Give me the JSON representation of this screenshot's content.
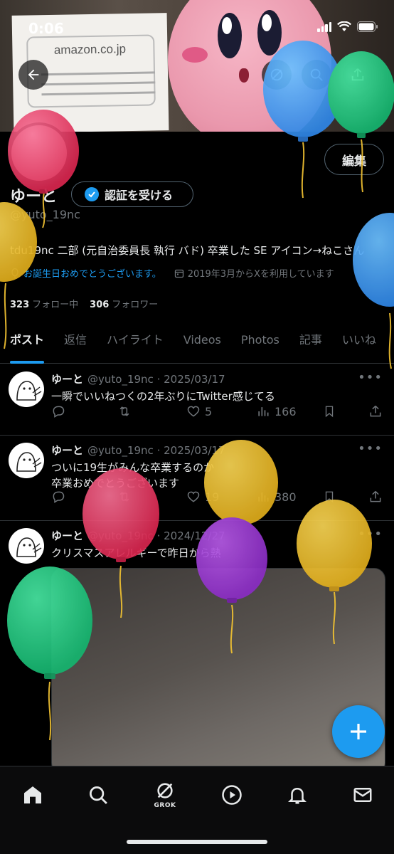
{
  "status_bar": {
    "time": "0:06"
  },
  "banner": {
    "paper_logo": "amazon.co.jp"
  },
  "header": {
    "edit_label": "編集"
  },
  "profile": {
    "name": "ゆーと",
    "verify_label": "認証を受ける",
    "handle": "@yuto_19nc",
    "bio": "tdu19nc 二部 (元自治委員長 執行 バド) 卒業した SE アイコン→ねこさん",
    "birthday": "お誕生日おめでとうございます。",
    "joined": "2019年3月からXを利用しています",
    "following_count": "323",
    "following_label": "フォロー中",
    "followers_count": "306",
    "followers_label": "フォロワー"
  },
  "tabs": [
    "ポスト",
    "返信",
    "ハイライト",
    "Videos",
    "Photos",
    "記事",
    "いいね"
  ],
  "posts": [
    {
      "name": "ゆーと",
      "sub": "@yuto_19nc · 2025/03/17",
      "text1": "一瞬でいいねつくの2年ぶりにTwitter感じてる",
      "text2": "",
      "likes": "5",
      "views": "166"
    },
    {
      "name": "ゆーと",
      "sub": "@yuto_19nc · 2025/03/17",
      "text1": "ついに19生がみんな卒業するのか",
      "text2": "卒業おめでとうございます",
      "likes": "19",
      "views": "380"
    },
    {
      "name": "ゆーと",
      "sub": "@yuto_19nc · 2024/12/27",
      "text1": "クリスマスアレルギーで昨日から熱",
      "text2": "",
      "likes": "",
      "views": ""
    }
  ],
  "bottom_nav": {
    "grok_label": "GROK"
  },
  "colors": {
    "accent": "#1d9bf0",
    "background": "#000000",
    "muted": "#71767b",
    "divider": "#2f3336"
  },
  "icons": [
    "back-arrow-icon",
    "grok-icon",
    "search-icon",
    "share-icon",
    "verified-badge-icon",
    "balloon-icon",
    "calendar-icon",
    "reply-icon",
    "retweet-icon",
    "heart-icon",
    "views-icon",
    "bookmark-icon",
    "plus-icon",
    "home-icon",
    "play-icon",
    "bell-icon",
    "mail-icon"
  ]
}
